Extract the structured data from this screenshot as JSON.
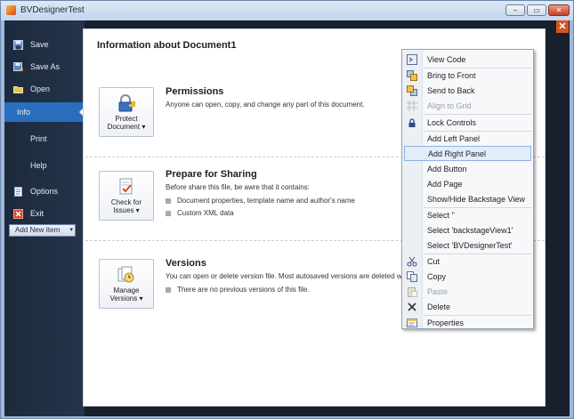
{
  "window": {
    "title": "BVDesignerTest",
    "min": "–",
    "max": "▭",
    "close": "✕"
  },
  "sidebar": {
    "items": [
      {
        "label": "Save",
        "icon": "save-icon"
      },
      {
        "label": "Save As",
        "icon": "save-as-icon"
      },
      {
        "label": "Open",
        "icon": "open-folder-icon"
      },
      {
        "label": "Info",
        "icon": "none",
        "selected": true
      },
      {
        "label": "Print",
        "icon": "none"
      },
      {
        "label": "Help",
        "icon": "none"
      },
      {
        "label": "Options",
        "icon": "options-icon"
      },
      {
        "label": "Exit",
        "icon": "exit-icon"
      }
    ],
    "add_new": "Add New Item"
  },
  "panel": {
    "title": "Information about Document1",
    "sections": [
      {
        "title": "Permissions",
        "desc": "Anyone can open, copy, and change any part of this document.",
        "button": [
          "Protect",
          "Document ▾"
        ],
        "bullets": []
      },
      {
        "title": "Prepare for Sharing",
        "desc": "Before share this file, be awre that it contains:",
        "button": [
          "Check for",
          "Issues ▾"
        ],
        "bullets": [
          "Document properties, template name and author's name",
          "Custom XML data"
        ]
      },
      {
        "title": "Versions",
        "desc": "You can open or delete version file. Most autosaved versions are deleted whe",
        "button": [
          "Manage",
          "Versions ▾"
        ],
        "bullets": [
          "There are no previous versions of this file."
        ]
      }
    ]
  },
  "close_x": "✕",
  "context_menu": [
    {
      "label": "View Code",
      "icon": "view-code-icon"
    },
    {
      "label": "Bring to Front",
      "icon": "bring-front-icon"
    },
    {
      "label": "Send to Back",
      "icon": "send-back-icon"
    },
    {
      "label": "Align to Grid",
      "icon": "grid-icon",
      "disabled": true
    },
    {
      "label": "Lock Controls",
      "icon": "lock-icon"
    },
    {
      "label": "Add Left Panel",
      "icon": "none"
    },
    {
      "label": "Add Right Panel",
      "icon": "none",
      "hover": true
    },
    {
      "label": "Add Button",
      "icon": "none"
    },
    {
      "label": "Add Page",
      "icon": "none"
    },
    {
      "label": "Show/Hide Backstage View",
      "icon": "none"
    },
    {
      "label": "Select ''",
      "icon": "none"
    },
    {
      "label": "Select 'backstageView1'",
      "icon": "none"
    },
    {
      "label": "Select 'BVDesignerTest'",
      "icon": "none"
    },
    {
      "label": "Cut",
      "icon": "cut-icon"
    },
    {
      "label": "Copy",
      "icon": "copy-icon"
    },
    {
      "label": "Paste",
      "icon": "paste-icon",
      "disabled": true
    },
    {
      "label": "Delete",
      "icon": "delete-icon"
    },
    {
      "label": "Properties",
      "icon": "properties-icon"
    }
  ],
  "colors": {
    "selected": "#2a6ebd",
    "sidebar": "#1d2a3d",
    "menu_hover": "#e3eefb"
  }
}
